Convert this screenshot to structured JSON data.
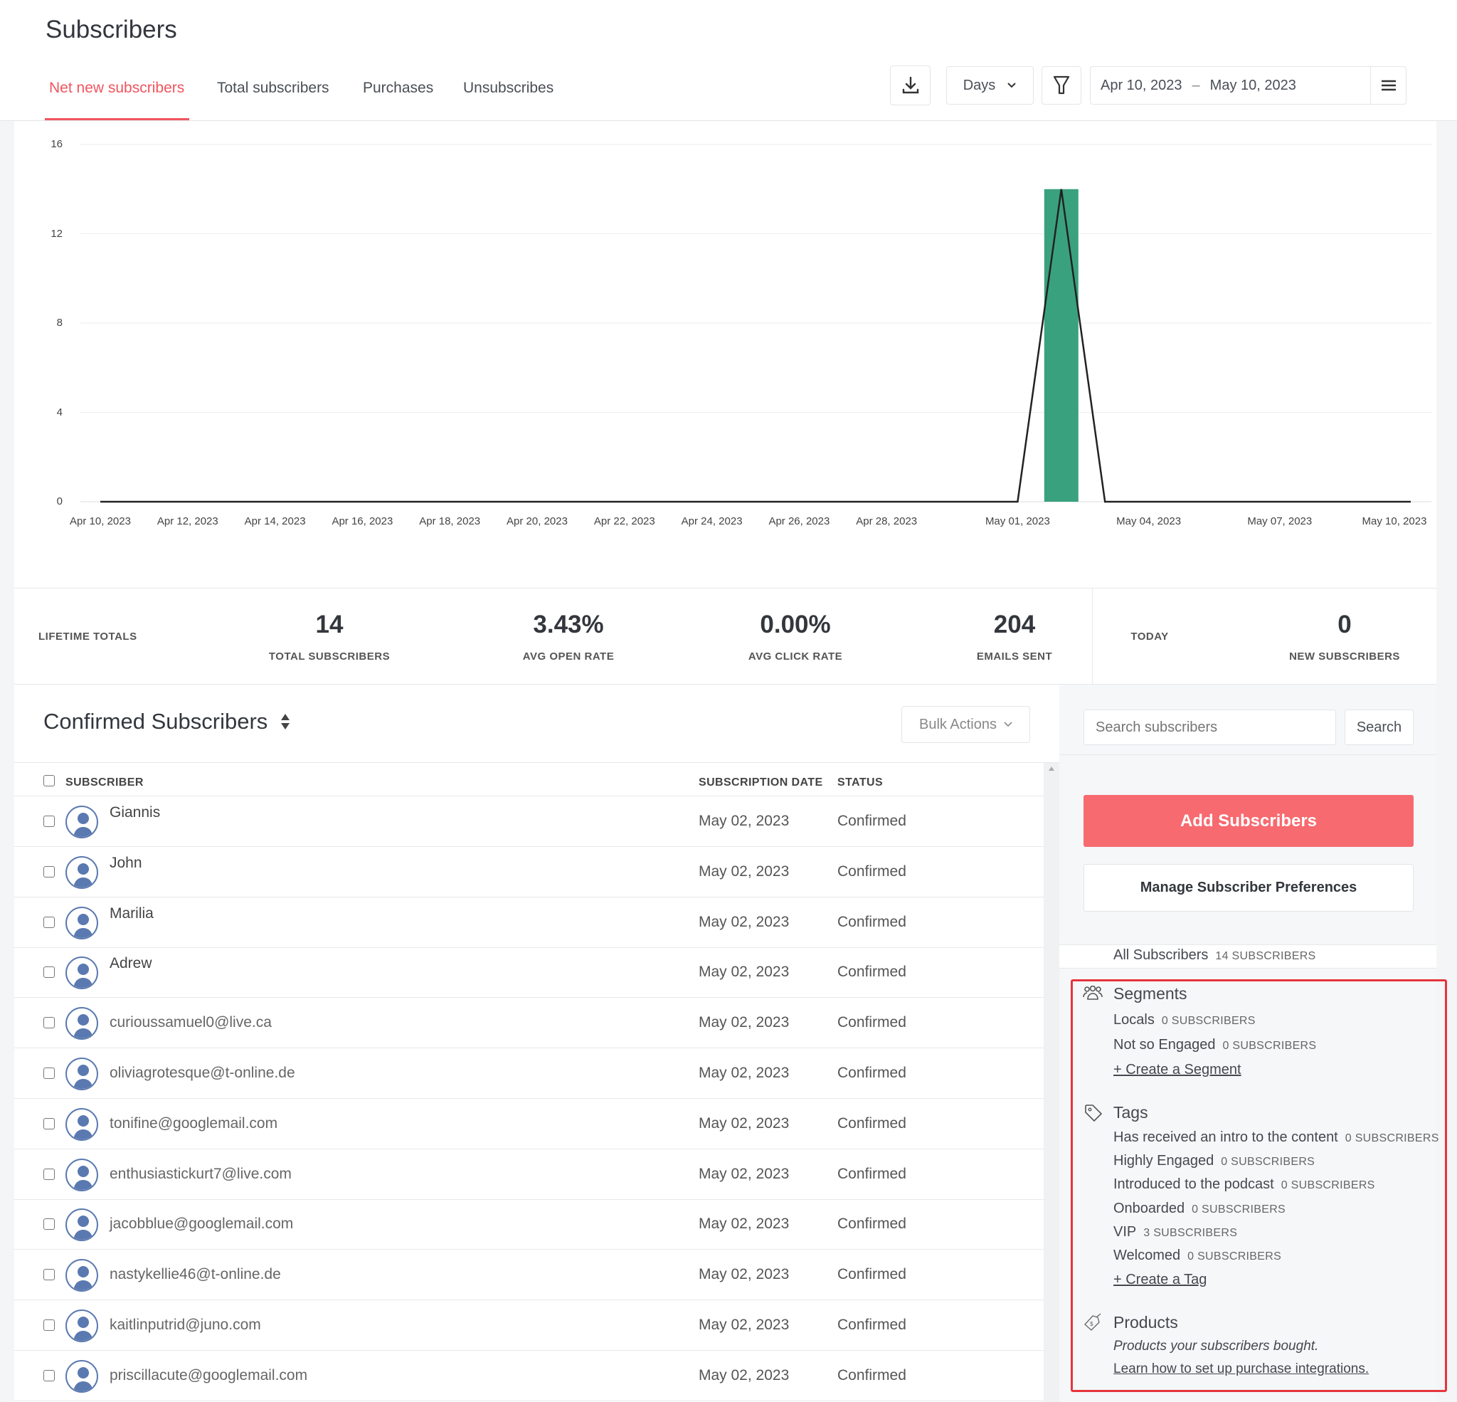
{
  "header": {
    "title": "Subscribers",
    "tabs": [
      {
        "label": "Net new subscribers",
        "active": true
      },
      {
        "label": "Total subscribers"
      },
      {
        "label": "Purchases"
      },
      {
        "label": "Unsubscribes"
      }
    ],
    "toolbar": {
      "download_icon": "download-icon",
      "interval": "Days",
      "filter_icon": "filter-icon",
      "date_start": "Apr 10, 2023",
      "date_sep": "–",
      "date_end": "May 10, 2023",
      "menu_icon": "hamburger-icon"
    }
  },
  "chart_data": {
    "type": "bar+line",
    "xlabel": "",
    "ylabel": "",
    "ylim": [
      0,
      16
    ],
    "yticks": [
      "0",
      "4",
      "8",
      "12",
      "16"
    ],
    "xticks": [
      {
        "label": "Apr 10, 2023",
        "day": 0
      },
      {
        "label": "Apr 12, 2023",
        "day": 2
      },
      {
        "label": "Apr 14, 2023",
        "day": 4
      },
      {
        "label": "Apr 16, 2023",
        "day": 6
      },
      {
        "label": "Apr 18, 2023",
        "day": 8
      },
      {
        "label": "Apr 20, 2023",
        "day": 10
      },
      {
        "label": "Apr 22, 2023",
        "day": 12
      },
      {
        "label": "Apr 24, 2023",
        "day": 14
      },
      {
        "label": "Apr 26, 2023",
        "day": 16
      },
      {
        "label": "Apr 28, 2023",
        "day": 18
      },
      {
        "label": "May 01, 2023",
        "day": 21
      },
      {
        "label": "May 04, 2023",
        "day": 24
      },
      {
        "label": "May 07, 2023",
        "day": 27
      },
      {
        "label": "May 10, 2023",
        "day": 30
      }
    ],
    "bars": [
      {
        "date": "May 02, 2023",
        "value": 14
      }
    ],
    "line": [
      {
        "date": "Apr 10, 2023",
        "value": 0
      },
      {
        "date": "May 01, 2023",
        "value": 0
      },
      {
        "date": "May 02, 2023",
        "value": 14
      },
      {
        "date": "May 03, 2023",
        "value": 0
      },
      {
        "date": "May 10, 2023",
        "value": 0
      }
    ],
    "bar_color": "#3aa17e",
    "line_color": "#222222"
  },
  "stats": {
    "lifetime_label": "LIFETIME TOTALS",
    "items": [
      {
        "value": "14",
        "label": "TOTAL SUBSCRIBERS"
      },
      {
        "value": "3.43%",
        "label": "AVG OPEN RATE"
      },
      {
        "value": "0.00%",
        "label": "AVG CLICK RATE"
      },
      {
        "value": "204",
        "label": "EMAILS SENT"
      }
    ],
    "today_label": "TODAY",
    "today": {
      "value": "0",
      "label": "NEW SUBSCRIBERS"
    }
  },
  "list": {
    "title": "Confirmed Subscribers",
    "bulk_actions": "Bulk Actions",
    "columns": [
      "SUBSCRIBER",
      "SUBSCRIPTION DATE",
      "STATUS"
    ],
    "rows": [
      {
        "name": "Giannis",
        "date": "May 02, 2023",
        "status": "Confirmed",
        "is_name": true
      },
      {
        "name": "John",
        "date": "May 02, 2023",
        "status": "Confirmed",
        "is_name": true
      },
      {
        "name": "Marilia",
        "date": "May 02, 2023",
        "status": "Confirmed",
        "is_name": true
      },
      {
        "name": "Adrew",
        "date": "May 02, 2023",
        "status": "Confirmed",
        "is_name": true
      },
      {
        "name": "curioussamuel0@live.ca",
        "date": "May 02, 2023",
        "status": "Confirmed"
      },
      {
        "name": "oliviagrotesque@t-online.de",
        "date": "May 02, 2023",
        "status": "Confirmed"
      },
      {
        "name": "tonifine@googlemail.com",
        "date": "May 02, 2023",
        "status": "Confirmed"
      },
      {
        "name": "enthusiastickurt7@live.com",
        "date": "May 02, 2023",
        "status": "Confirmed"
      },
      {
        "name": "jacobblue@googlemail.com",
        "date": "May 02, 2023",
        "status": "Confirmed"
      },
      {
        "name": "nastykellie46@t-online.de",
        "date": "May 02, 2023",
        "status": "Confirmed"
      },
      {
        "name": "kaitlinputrid@juno.com",
        "date": "May 02, 2023",
        "status": "Confirmed"
      },
      {
        "name": "priscillacute@googlemail.com",
        "date": "May 02, 2023",
        "status": "Confirmed"
      }
    ]
  },
  "sidebar": {
    "search_placeholder": "Search subscribers",
    "search_button": "Search",
    "add_button": "Add Subscribers",
    "manage_button": "Manage Subscriber Preferences",
    "all": {
      "label": "All Subscribers",
      "count": "14 SUBSCRIBERS"
    },
    "segments": {
      "title": "Segments",
      "items": [
        {
          "label": "Locals",
          "count": "0 SUBSCRIBERS"
        },
        {
          "label": "Not so Engaged",
          "count": "0 SUBSCRIBERS"
        }
      ],
      "create": "+ Create a Segment"
    },
    "tags": {
      "title": "Tags",
      "items": [
        {
          "label": "Has received an intro to the content",
          "count": "0 SUBSCRIBERS"
        },
        {
          "label": "Highly Engaged",
          "count": "0 SUBSCRIBERS"
        },
        {
          "label": "Introduced to the podcast",
          "count": "0 SUBSCRIBERS"
        },
        {
          "label": "Onboarded",
          "count": "0 SUBSCRIBERS"
        },
        {
          "label": "VIP",
          "count": "3 SUBSCRIBERS"
        },
        {
          "label": "Welcomed",
          "count": "0 SUBSCRIBERS"
        }
      ],
      "create": "+ Create a Tag"
    },
    "products": {
      "title": "Products",
      "desc": "Products your subscribers bought.",
      "link": "Learn how to set up purchase integrations."
    },
    "highlight_color": "#e5353c"
  },
  "colors": {
    "accent": "#f0555f",
    "add_button": "#f76a70"
  }
}
